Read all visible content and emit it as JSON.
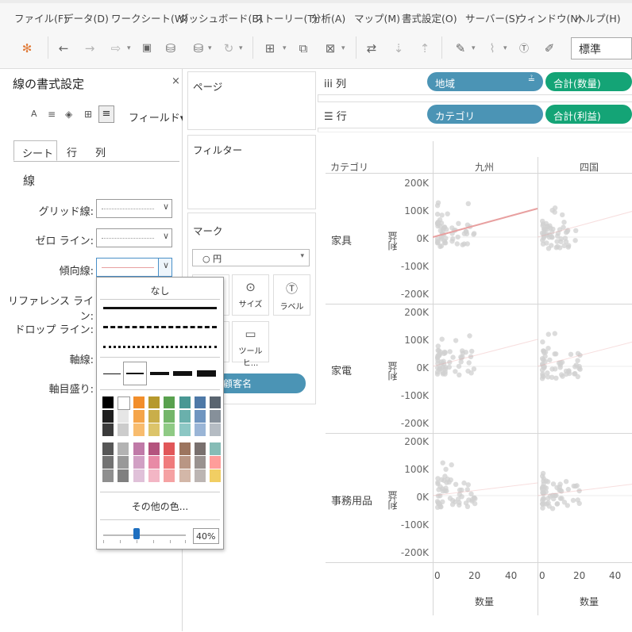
{
  "menu": [
    "ファイル(F)",
    "データ(D)",
    "ワークシート(W)",
    "ダッシュボード(B)",
    "ストーリー(T)",
    "分析(A)",
    "マップ(M)",
    "書式設定(O)",
    "サーバー(S)",
    "ウィンドウ(N)",
    "ヘルプ(H)"
  ],
  "toolbar": {
    "fit_value": "標準"
  },
  "format_pane": {
    "title": "線の書式設定",
    "close": "×",
    "fields_button": "フィールド▾",
    "tabs": [
      "シート",
      "行",
      "列"
    ],
    "section": "線",
    "rows": [
      {
        "label": "グリッド線:"
      },
      {
        "label": "ゼロ ライン:"
      },
      {
        "label": "傾向線:"
      },
      {
        "label": "リファレンス ライン:"
      },
      {
        "label": "ドロップ ライン:"
      },
      {
        "label": "軸線:"
      },
      {
        "label": "軸目盛り:"
      }
    ]
  },
  "line_popup": {
    "none_label": "なし",
    "more_colors": "その他の色...",
    "opacity_value": "40%",
    "opacity": 0.4,
    "palette_columns": [
      [
        "#000000",
        "#1f1f1f",
        "#3b3b3b",
        "#575757",
        "#737373",
        "#8f8f8f"
      ],
      [
        "#ffffff",
        "#e6e6e6",
        "#cccccc",
        "#b3b3b3",
        "#999999",
        "#808080"
      ],
      [
        "#f28e2b",
        "#f5a54a",
        "#f8bc6e",
        "#c07aa8",
        "#d1a0c4",
        "#e0c1d9"
      ],
      [
        "#b6992d",
        "#c9ae4a",
        "#dcc46a",
        "#b4547e",
        "#e88aa6",
        "#f3b6c5"
      ],
      [
        "#59a14f",
        "#74b66a",
        "#8fca85",
        "#e15759",
        "#f07c7d",
        "#f5a2a3"
      ],
      [
        "#499894",
        "#6ab0ac",
        "#8cc7c4",
        "#9c755f",
        "#b99684",
        "#d3b7a8"
      ],
      [
        "#4e79a7",
        "#6f95c0",
        "#9ab5d6",
        "#79706e",
        "#9a9290",
        "#bcb5b3"
      ],
      [
        "#5a6570",
        "#86909a",
        "#b5bcc3",
        "#86bcb6",
        "#ff9d9a",
        "#f1ce63"
      ]
    ]
  },
  "shelves": {
    "pages": "ページ",
    "filters": "フィルター",
    "marks": "マーク",
    "mark_type": "○ 円",
    "mark_buttons": [
      {
        "label": "サイズ",
        "icon": "size-icon"
      },
      {
        "label": "ラベル",
        "icon": "label-icon"
      },
      {
        "label": "ツールヒ...",
        "icon": "tooltip-icon"
      }
    ],
    "customer_pill": "顧客名",
    "columns_label": "iii 列",
    "rows_label": "☰ 行",
    "col_pills": [
      "地域",
      "合計(数量)"
    ],
    "row_pills": [
      "カテゴリ",
      "合計(利益)"
    ]
  },
  "view": {
    "category_header": "カテゴリ",
    "region_headers": [
      "九州",
      "四国"
    ],
    "categories": [
      "家具",
      "家電",
      "事務用品"
    ],
    "y_axis_title": "利益",
    "x_axis_title": "数量",
    "y_ticks": [
      "200K",
      "100K",
      "0K",
      "-100K",
      "-200K"
    ],
    "x_ticks": [
      "0",
      "20",
      "40"
    ]
  },
  "colors": {
    "dimension_pill": "#4b94b5",
    "measure_pill": "#14a476",
    "trend_line": "#e8a0a0",
    "points": "#d0d0d0"
  }
}
